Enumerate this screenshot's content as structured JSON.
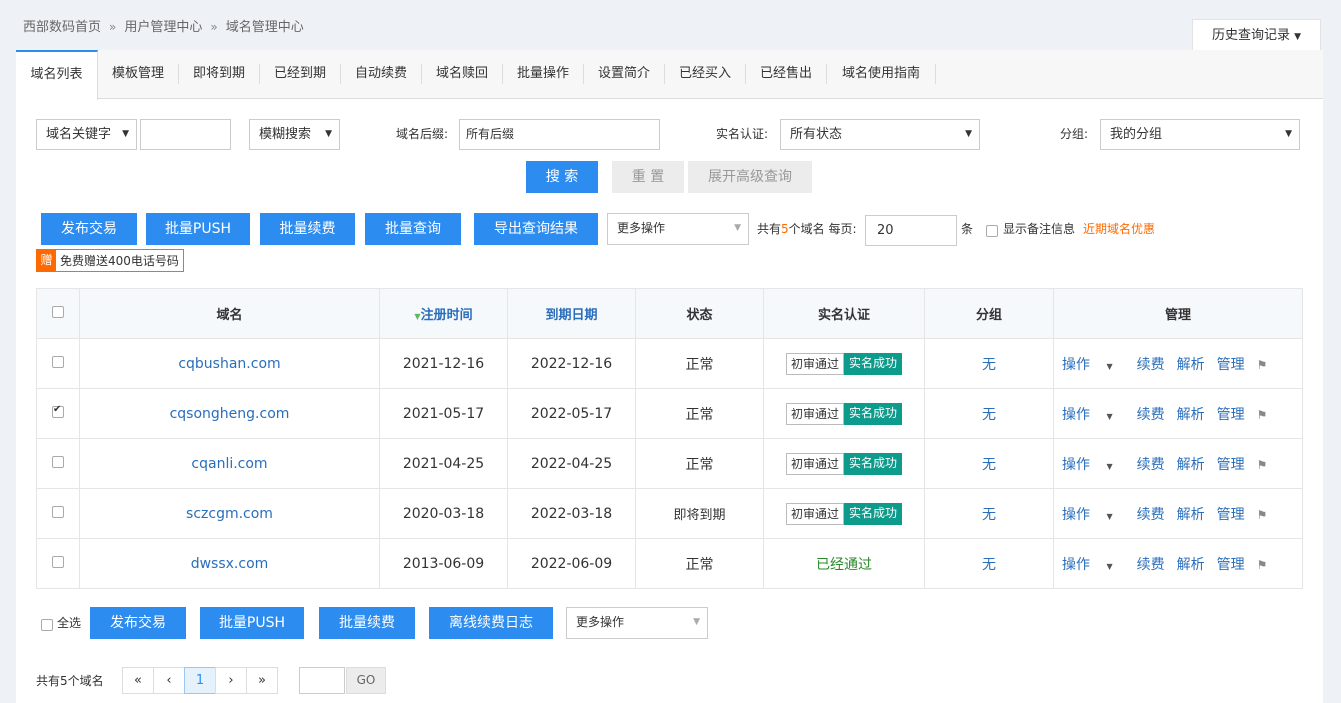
{
  "breadcrumb": [
    "西部数码首页",
    "用户管理中心",
    "域名管理中心"
  ],
  "history_label": "历史查询记录",
  "tabs": [
    "域名列表",
    "模板管理",
    "即将到期",
    "已经到期",
    "自动续费",
    "域名赎回",
    "批量操作",
    "设置简介",
    "已经买入",
    "已经售出",
    "域名使用指南"
  ],
  "search": {
    "keyword_select": "域名关键字",
    "keyword_value": "",
    "mode_select": "模糊搜索",
    "suffix_label": "域名后缀:",
    "suffix_value": "所有后缀",
    "realname_label": "实名认证:",
    "realname_value": "所有状态",
    "group_label": "分组:",
    "group_value": "我的分组",
    "search_btn": "搜 索",
    "reset_btn": "重 置",
    "advanced_btn": "展开高级查询"
  },
  "actions": {
    "publish": "发布交易",
    "push": "批量PUSH",
    "renew": "批量续费",
    "query": "批量查询",
    "export": "导出查询结果",
    "more": "更多操作",
    "total_prefix": "共有",
    "total_count": "5",
    "total_suffix": "个域名 每页:",
    "per_page": "20",
    "per_page_unit": "条",
    "show_notes": "显示备注信息",
    "promo": "近期域名优惠"
  },
  "gift": {
    "icon": "赠",
    "text": "免费赠送400电话号码"
  },
  "table": {
    "headers": [
      "域名",
      "注册时间",
      "到期日期",
      "状态",
      "实名认证",
      "分组",
      "管理"
    ],
    "rows": [
      {
        "domain": "cqbushan.com",
        "reg": "2021-12-16",
        "exp": "2022-12-16",
        "status": "正常",
        "auth1": "初审通过",
        "auth2": "实名成功",
        "group": "无",
        "checked": false
      },
      {
        "domain": "cqsongheng.com",
        "reg": "2021-05-17",
        "exp": "2022-05-17",
        "status": "正常",
        "auth1": "初审通过",
        "auth2": "实名成功",
        "group": "无",
        "checked": true
      },
      {
        "domain": "cqanli.com",
        "reg": "2021-04-25",
        "exp": "2022-04-25",
        "status": "正常",
        "auth1": "初审通过",
        "auth2": "实名成功",
        "group": "无",
        "checked": false
      },
      {
        "domain": "sczcgm.com",
        "reg": "2020-03-18",
        "exp": "2022-03-18",
        "status": "即将到期",
        "auth1": "初审通过",
        "auth2": "实名成功",
        "group": "无",
        "checked": false
      },
      {
        "domain": "dwssx.com",
        "reg": "2013-06-09",
        "exp": "2022-06-09",
        "status": "正常",
        "auth_text": "已经通过",
        "group": "无",
        "checked": false
      }
    ],
    "manage_links": [
      "操作",
      "续费",
      "解析",
      "管理"
    ]
  },
  "bottom": {
    "select_all": "全选",
    "publish": "发布交易",
    "push": "批量PUSH",
    "renew": "批量续费",
    "offline_log": "离线续费日志",
    "more": "更多操作",
    "total": "共有5个域名",
    "pages": [
      "«",
      "‹",
      "1",
      "›",
      "»"
    ],
    "go": "GO"
  },
  "colors": {
    "primary": "#2d8cf0",
    "warning": "#e4393c",
    "success": "#0d9b8b",
    "orange": "#ff6a00"
  }
}
